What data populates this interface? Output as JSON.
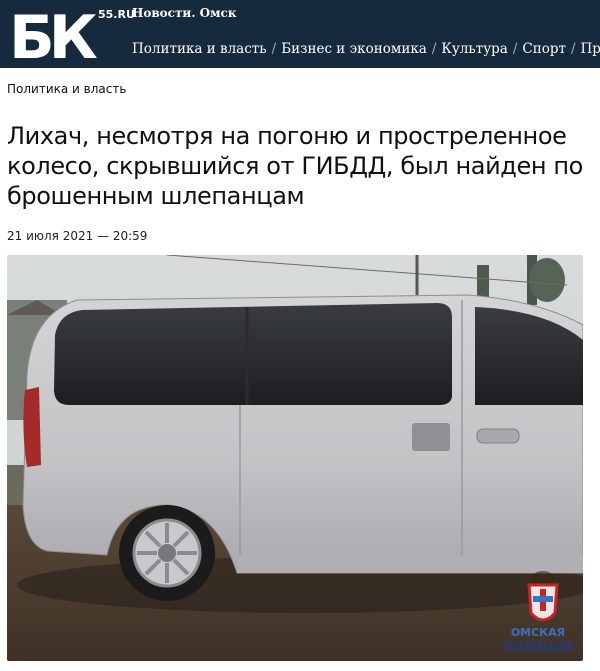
{
  "site": {
    "logo_text": "БК",
    "logo_suffix": "55.RU",
    "tagline": "Новости. Омск"
  },
  "nav": {
    "items": [
      {
        "label": "Политика и власть"
      },
      {
        "label": "Бизнес и экономика"
      },
      {
        "label": "Культура"
      },
      {
        "label": "Спорт"
      },
      {
        "label": "Прои"
      }
    ],
    "separator": "/"
  },
  "breadcrumb": "Политика и власть",
  "article": {
    "title": "Лихач, несмотря на погоню и простреленное колесо, скрывшийся от ГИБДД, был найден по брошенным шлепанцам",
    "date": "21 июля 2021 — 20:59"
  },
  "photo": {
    "watermark_line1": "ОМСКАЯ",
    "watermark_line2": "ПОЛИЦИЯ"
  },
  "colors": {
    "header_bg": "#162a3e",
    "van_body": "#c9c9cb"
  }
}
